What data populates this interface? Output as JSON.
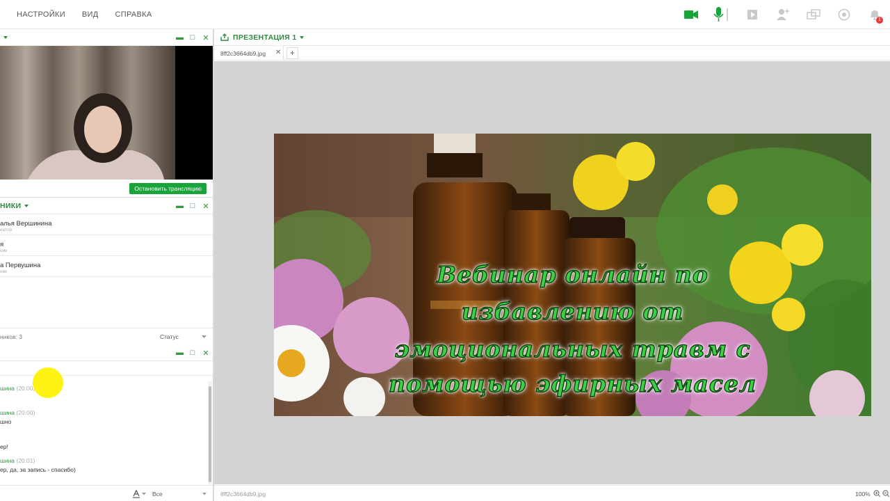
{
  "menu": {
    "settings": "НАСТРОЙКИ",
    "view": "ВИД",
    "help": "СПРАВКА"
  },
  "toolbar": {
    "icons": [
      "camera-icon",
      "microphone-icon",
      "media-icon",
      "add-user-icon",
      "screen-share-icon",
      "record-icon",
      "notification-icon"
    ],
    "notification_count": "1",
    "accent": "#19a33a"
  },
  "video_panel": {
    "stop_label": "Остановить трансляцию"
  },
  "members_panel": {
    "title": "НИКИ",
    "members": [
      {
        "name": "алья Вершинина",
        "role": "иатор"
      },
      {
        "name": "я",
        "role": "ник"
      },
      {
        "name": "а Первушина",
        "role": "ник"
      }
    ],
    "count_label": "ников: 3",
    "status_label": "Статус"
  },
  "chat_panel": {
    "messages": [
      {
        "author": "шина",
        "time": "(20:00)",
        "text": ""
      },
      {
        "author": "шина",
        "time": "(20:00)",
        "text": "шно"
      },
      {
        "author": "",
        "time": "",
        "text": "ер!"
      },
      {
        "author": "шина",
        "time": "(20:01)",
        "text": "ер, да, за запись - спасибо)"
      }
    ],
    "audience_label": "Все"
  },
  "presentation": {
    "title": "ПРЕЗЕНТАЦИЯ 1",
    "tab_name": "8ff2c3664db9.jpg",
    "footer_filename": "8ff2c3664db9.jpg",
    "zoom": "100%",
    "slide_lines": [
      "Вебинар онлайн по",
      "избавлению от",
      "эмоциональных травм с",
      "помощью эфирных масел"
    ]
  }
}
